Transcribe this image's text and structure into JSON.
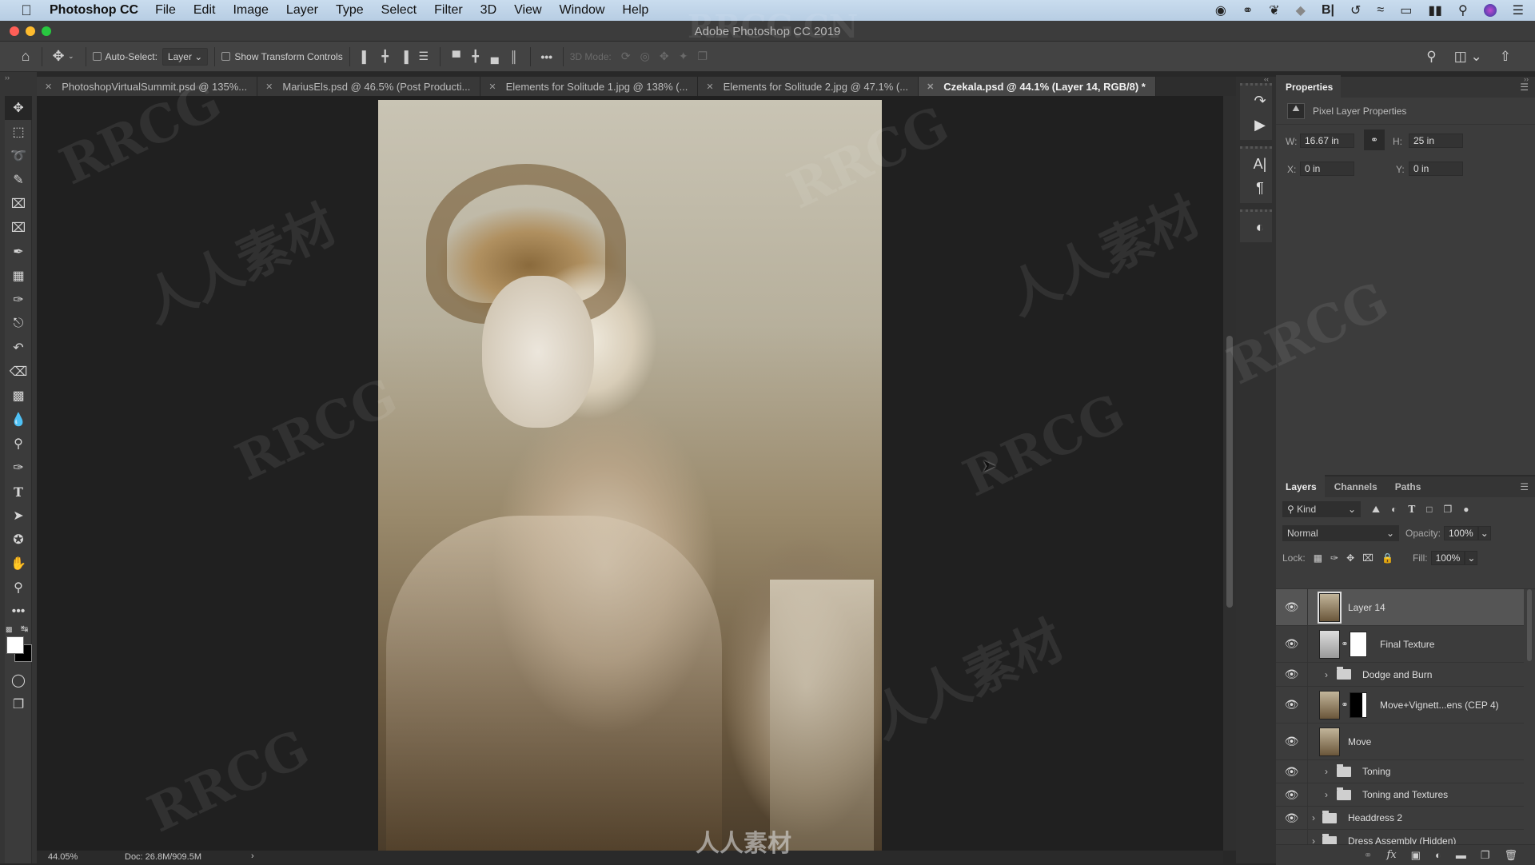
{
  "menubar": {
    "apple": "",
    "app_name": "Photoshop CC",
    "items": [
      "File",
      "Edit",
      "Image",
      "Layer",
      "Type",
      "Select",
      "Filter",
      "3D",
      "View",
      "Window",
      "Help"
    ],
    "tray_icons": [
      "screen-record-icon",
      "creative-cloud-icon",
      "butterfly-icon",
      "tag-icon",
      "bartender-icon",
      "time-machine-icon",
      "wifi-icon",
      "airplay-icon",
      "battery-icon",
      "spotlight-icon",
      "siri-icon",
      "notification-center-icon"
    ]
  },
  "window": {
    "title": "Adobe Photoshop CC 2019",
    "traffic_lights": {
      "close": "#ff5f57",
      "minimize": "#febc2e",
      "zoom": "#28c840"
    }
  },
  "options_bar": {
    "auto_select_label": "Auto-Select:",
    "auto_select_checked": false,
    "auto_select_target": "Layer",
    "show_transform_label": "Show Transform Controls",
    "show_transform_checked": false,
    "mode_3d_label": "3D Mode:"
  },
  "tabs": [
    {
      "label": "PhotoshopVirtualSummit.psd @ 135%...",
      "active": false
    },
    {
      "label": "MariusEls.psd @ 46.5% (Post Producti...",
      "active": false
    },
    {
      "label": "Elements for Solitude 1.jpg @ 138% (...",
      "active": false
    },
    {
      "label": "Elements for Solitude 2.jpg @ 47.1% (...",
      "active": false
    },
    {
      "label": "Czekala.psd @ 44.1% (Layer 14, RGB/8) *",
      "active": true
    }
  ],
  "tools": [
    "move",
    "rectangular-marquee",
    "lasso",
    "quick-selection",
    "crop",
    "frame",
    "eyedropper",
    "healing-brush",
    "brush",
    "clone-stamp",
    "history-brush",
    "eraser",
    "gradient",
    "blur",
    "dodge",
    "pen",
    "type",
    "path-selection",
    "custom-shape",
    "hand",
    "zoom",
    "edit-toolbar"
  ],
  "colors": {
    "foreground": "#ffffff",
    "background": "#000000"
  },
  "status": {
    "zoom": "44.05%",
    "doc": "Doc: 26.8M/909.5M"
  },
  "properties": {
    "title": "Properties",
    "subtitle": "Pixel Layer Properties",
    "w_label": "W:",
    "w_value": "16.67 in",
    "h_label": "H:",
    "h_value": "25 in",
    "x_label": "X:",
    "x_value": "0 in",
    "y_label": "Y:",
    "y_value": "0 in"
  },
  "layers_panel": {
    "tabs": [
      "Layers",
      "Channels",
      "Paths"
    ],
    "filter_kind": "Kind",
    "blend_mode": "Normal",
    "opacity_label": "Opacity:",
    "opacity": "100%",
    "lock_label": "Lock:",
    "fill_label": "Fill:",
    "fill": "100%",
    "layers": [
      {
        "name": "Layer 14",
        "type": "pixel",
        "visible": true,
        "selected": true
      },
      {
        "name": "Final Texture",
        "type": "pixel-mask",
        "visible": true,
        "selected": false
      },
      {
        "name": "Dodge and Burn",
        "type": "group",
        "visible": true,
        "selected": false
      },
      {
        "name": "Move+Vignett...ens (CEP 4)",
        "type": "pixel-mask",
        "visible": true,
        "selected": false
      },
      {
        "name": "Move",
        "type": "pixel",
        "visible": true,
        "selected": false
      },
      {
        "name": "Toning",
        "type": "group",
        "visible": true,
        "selected": false
      },
      {
        "name": "Toning and Textures",
        "type": "group",
        "visible": true,
        "selected": false
      },
      {
        "name": "Headdress 2",
        "type": "group",
        "visible": true,
        "selected": false
      },
      {
        "name": "Dress Assembly (Hidden)",
        "type": "group",
        "visible": false,
        "selected": false
      }
    ]
  },
  "watermarks": [
    "RRCG",
    "人人素材",
    "RRCG.CN"
  ]
}
